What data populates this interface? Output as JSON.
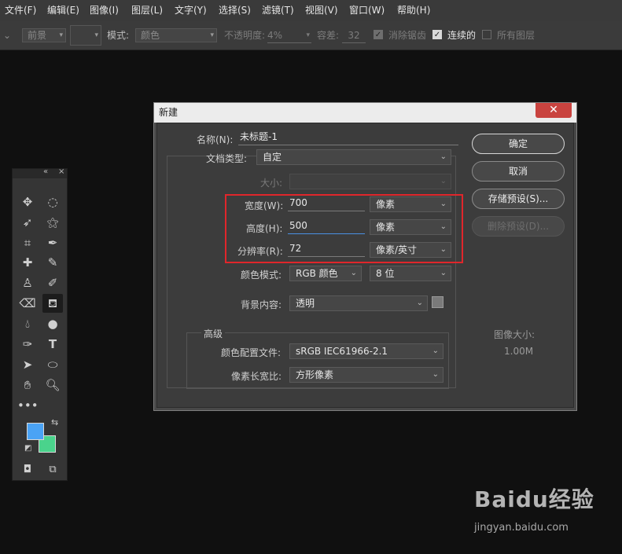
{
  "menubar": {
    "items": [
      "文件(F)",
      "编辑(E)",
      "图像(I)",
      "图层(L)",
      "文字(Y)",
      "选择(S)",
      "滤镜(T)",
      "视图(V)",
      "窗口(W)",
      "帮助(H)"
    ]
  },
  "options_bar": {
    "fill_source_value": "前景",
    "mode_label": "模式:",
    "mode_value": "颜色",
    "opacity_label": "不透明度:",
    "opacity_value": "4%",
    "tolerance_label": "容差:",
    "tolerance_value": "32",
    "antialias_label": "消除锯齿",
    "antialias_checked": true,
    "contiguous_label": "连续的",
    "contiguous_checked": true,
    "all_layers_label": "所有图层",
    "all_layers_checked": false
  },
  "toolbox": {
    "tools": [
      "move-tool",
      "elliptical-marquee-tool",
      "lasso-tool",
      "magic-wand-tool",
      "crop-tool",
      "eyedropper-tool",
      "healing-brush-tool",
      "brush-tool",
      "clone-stamp-tool",
      "history-brush-tool",
      "eraser-tool",
      "paint-bucket-tool",
      "blur-tool",
      "dodge-tool",
      "pen-tool",
      "type-tool",
      "path-selection-tool",
      "ellipse-tool",
      "hand-tool",
      "zoom-tool",
      "more-tools"
    ],
    "active_tool": "paint-bucket-tool",
    "foreground_color": "#4aa3f5",
    "background_color": "#4ad38c"
  },
  "dialog": {
    "title": "新建",
    "name_label": "名称(N):",
    "name_value": "未标题-1",
    "doc_type_label": "文档类型:",
    "doc_type_value": "自定",
    "size_label": "大小:",
    "size_value": "",
    "width_label": "宽度(W):",
    "width_value": "700",
    "width_unit": "像素",
    "height_label": "高度(H):",
    "height_value": "500",
    "height_unit": "像素",
    "resolution_label": "分辨率(R):",
    "resolution_value": "72",
    "resolution_unit": "像素/英寸",
    "color_mode_label": "颜色模式:",
    "color_mode_value": "RGB 颜色",
    "bit_depth_value": "8 位",
    "background_label": "背景内容:",
    "background_value": "透明",
    "advanced_label": "高级",
    "color_profile_label": "颜色配置文件:",
    "color_profile_value": "sRGB IEC61966-2.1",
    "pixel_aspect_label": "像素长宽比:",
    "pixel_aspect_value": "方形像素",
    "image_size_label": "图像大小:",
    "image_size_value": "1.00M",
    "buttons": {
      "ok": "确定",
      "cancel": "取消",
      "save_preset": "存储预设(S)...",
      "delete_preset": "删除预设(D)..."
    }
  },
  "watermark": {
    "brand": "Baidu经验",
    "url": "jingyan.baidu.com"
  },
  "colors": {
    "highlight_box": "#e0262b",
    "close_button": "#c9433f"
  }
}
